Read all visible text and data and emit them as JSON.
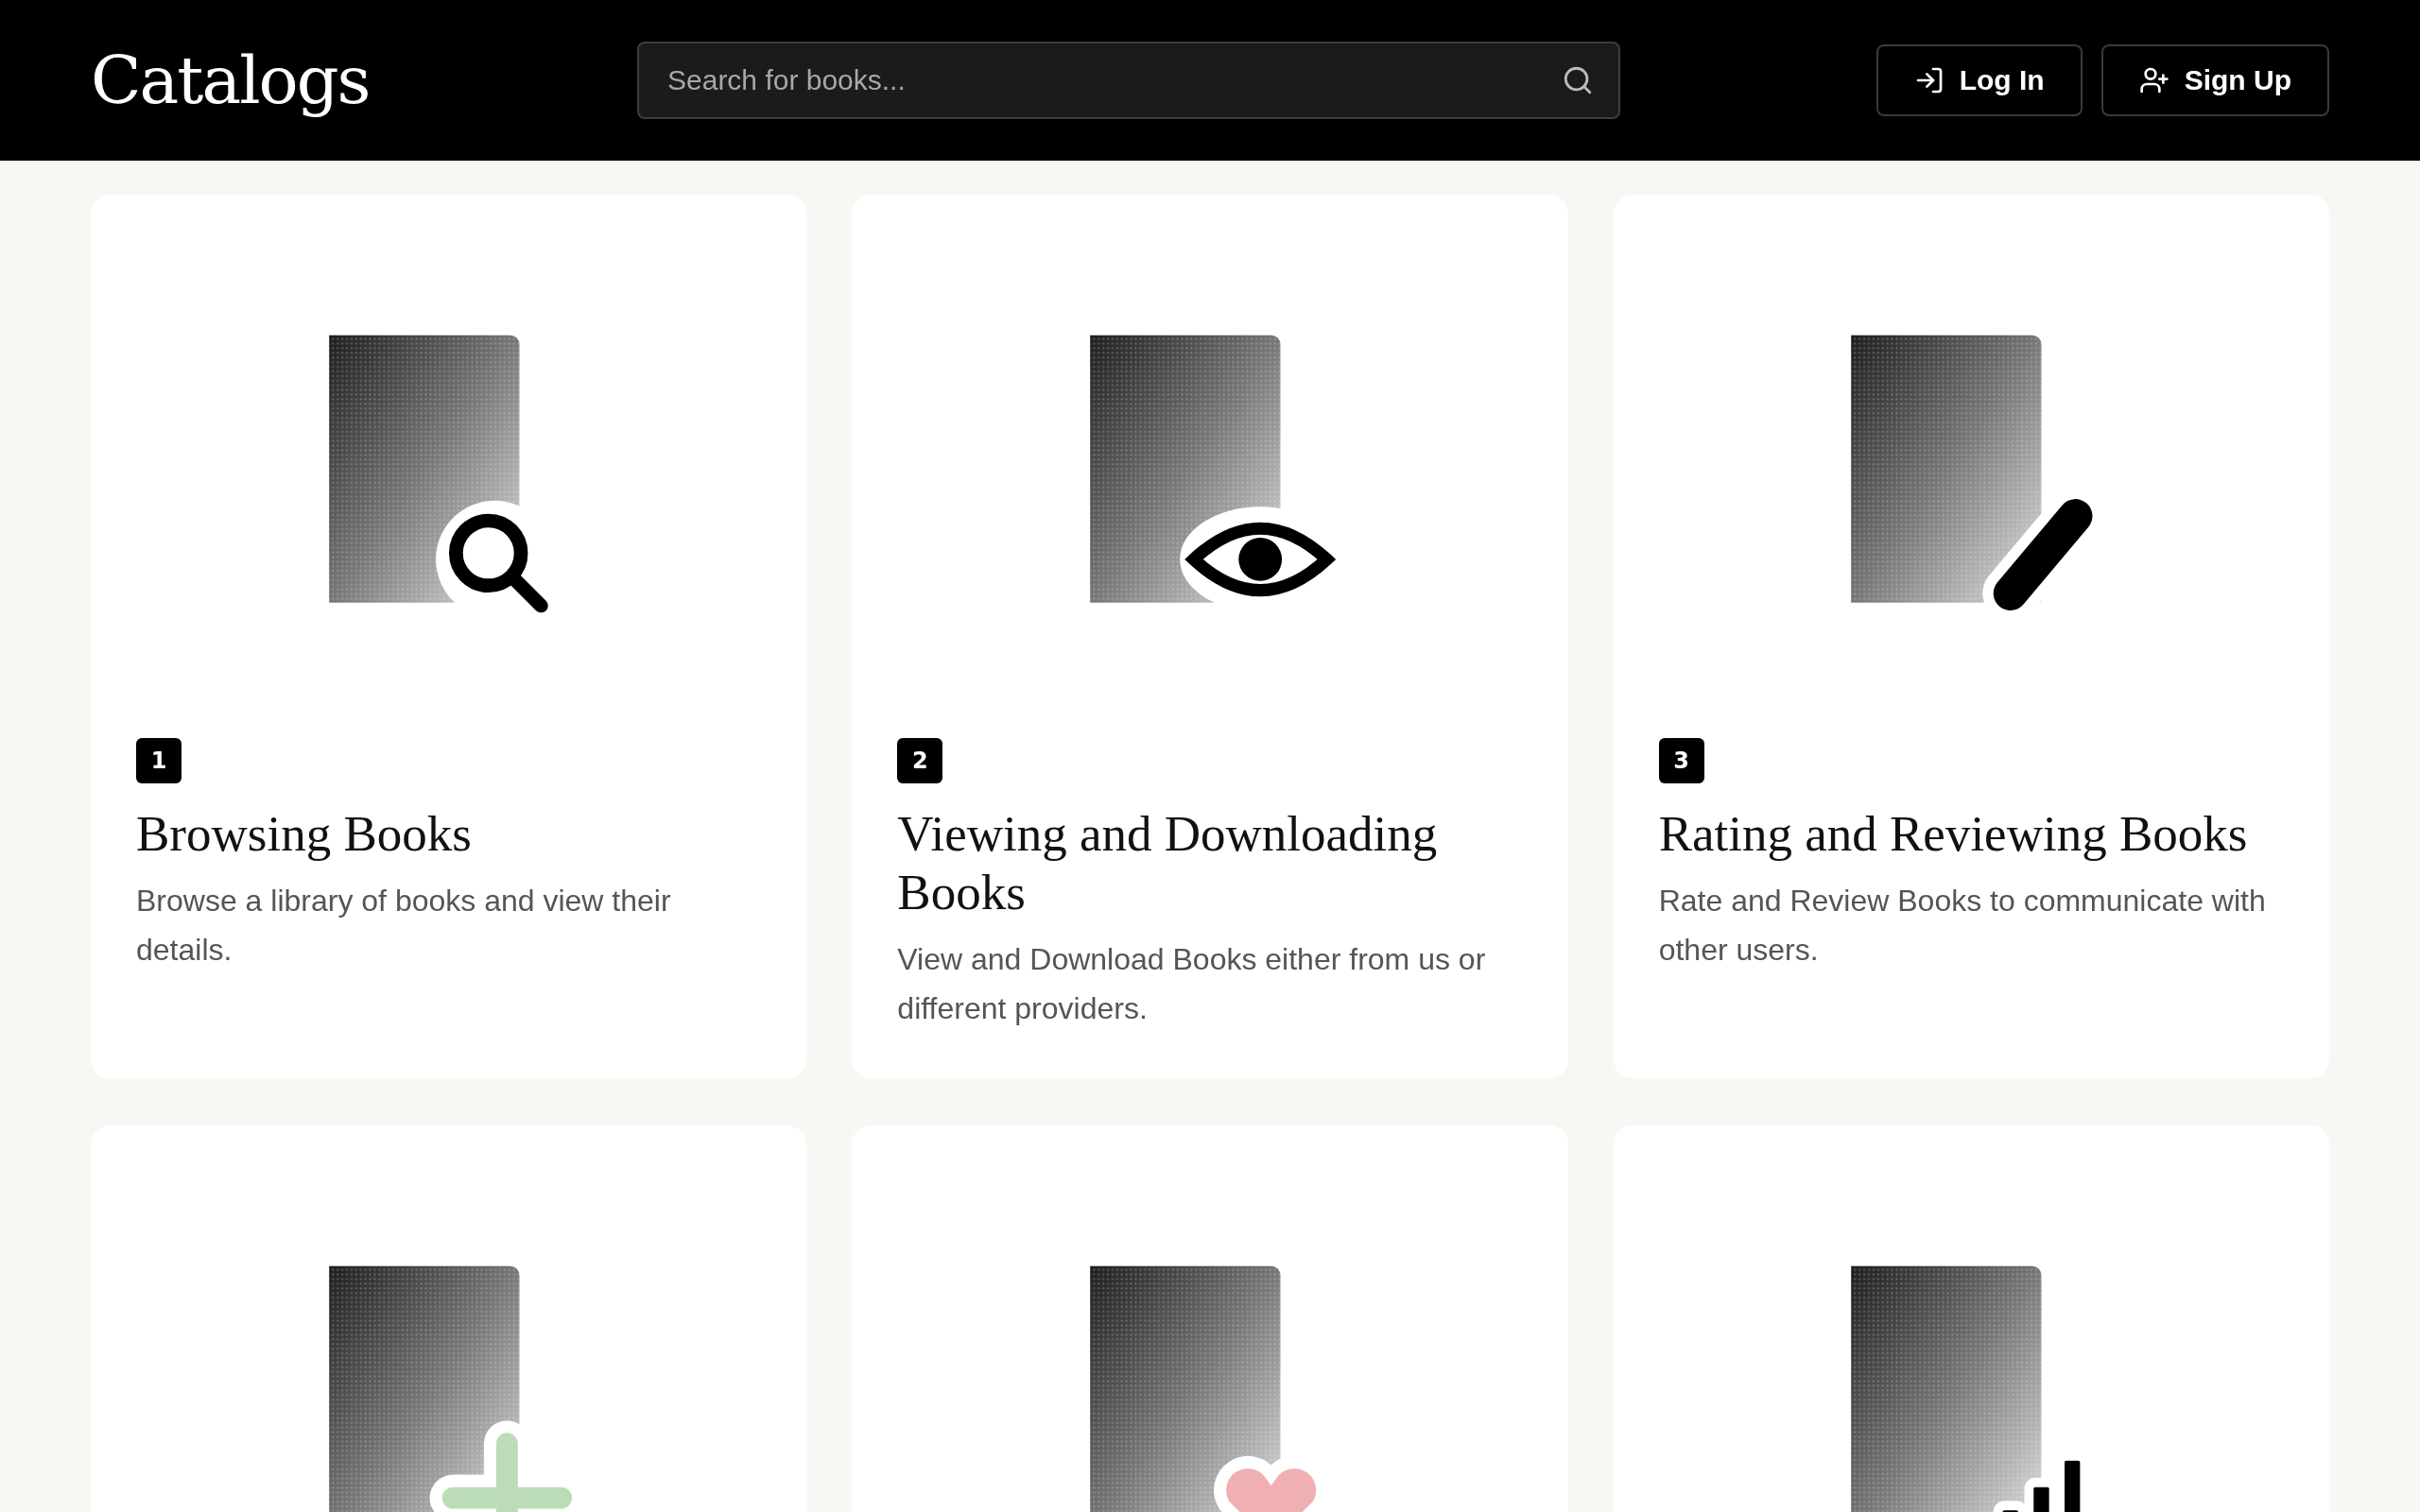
{
  "header": {
    "logo": "Catalogs",
    "search": {
      "placeholder": "Search for books..."
    },
    "buttons": [
      {
        "kind": "login",
        "label": "Log In"
      },
      {
        "kind": "signup",
        "label": "Sign Up"
      }
    ]
  },
  "cards": [
    {
      "icon": {
        "kind": "search",
        "color": "#000000"
      },
      "number": "1",
      "title": "Browsing Books",
      "description": "Browse a library of books and view their details."
    },
    {
      "icon": {
        "kind": "eye",
        "color": "#000000"
      },
      "number": "2",
      "title": "Viewing and Downloading Books",
      "description": "View and Download Books either from us or different providers."
    },
    {
      "icon": {
        "kind": "pencil",
        "color": "#000000"
      },
      "number": "3",
      "title": "Rating and Reviewing Books",
      "description": "Rate and Review Books to communicate with other users."
    },
    {
      "icon": {
        "kind": "plus",
        "color": "#bcdcb8"
      }
    },
    {
      "icon": {
        "kind": "heart",
        "color": "#f0b0b2"
      }
    },
    {
      "icon": {
        "kind": "chart",
        "color": "#000000"
      }
    }
  ]
}
